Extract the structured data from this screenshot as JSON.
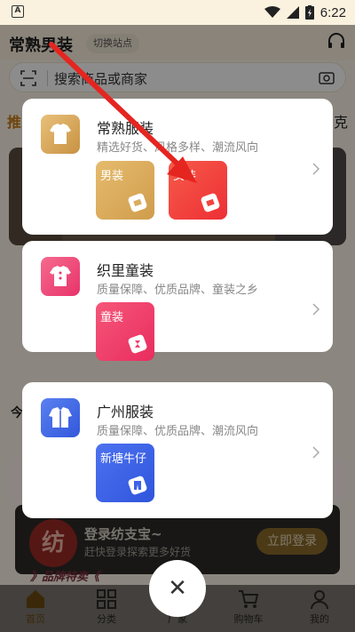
{
  "status_bar": {
    "left_badge": "A",
    "time": "6:22"
  },
  "header": {
    "site_title": "常熟男装",
    "switch_site": "切换站点"
  },
  "search": {
    "placeholder": "搜索商品或商家"
  },
  "background": {
    "tab_first": "推",
    "tab_last": "克",
    "section_char": "今"
  },
  "login_banner": {
    "logo_text": "纺",
    "title": "登录纺支宝~",
    "subtitle": "赶快登录探索更多好货",
    "button": "立即登录"
  },
  "brand_strip": "》品牌特卖《",
  "categories": [
    {
      "title": "常熟服装",
      "desc": "精选好货、风格多样、潮流风向",
      "icon": "tshirt-icon",
      "tiles": [
        {
          "label": "男装",
          "icon": "tag-icon",
          "color": "#d9ad5e"
        },
        {
          "label": "女装",
          "icon": "tag-icon",
          "color": "#f0453f"
        }
      ]
    },
    {
      "title": "织里童装",
      "desc": "质量保障、优质品牌、童装之乡",
      "icon": "kids-shirt-icon",
      "tiles": [
        {
          "label": "童装",
          "icon": "child-icon",
          "color": "#ee3f6e"
        }
      ]
    },
    {
      "title": "广州服装",
      "desc": "质量保障、优质品牌、潮流风向",
      "icon": "jacket-icon",
      "tiles": [
        {
          "label": "新塘牛仔",
          "icon": "jeans-icon",
          "color": "#3d63e8"
        }
      ]
    }
  ],
  "bottom_nav": [
    {
      "label": "首页",
      "icon": "home-icon"
    },
    {
      "label": "分类",
      "icon": "grid-icon"
    },
    {
      "label": "厂家",
      "icon": "factory-icon"
    },
    {
      "label": "购物车",
      "icon": "cart-icon"
    },
    {
      "label": "我的",
      "icon": "user-icon"
    }
  ],
  "colors": {
    "accent": "#c97a10",
    "arrow": "#e52520"
  }
}
